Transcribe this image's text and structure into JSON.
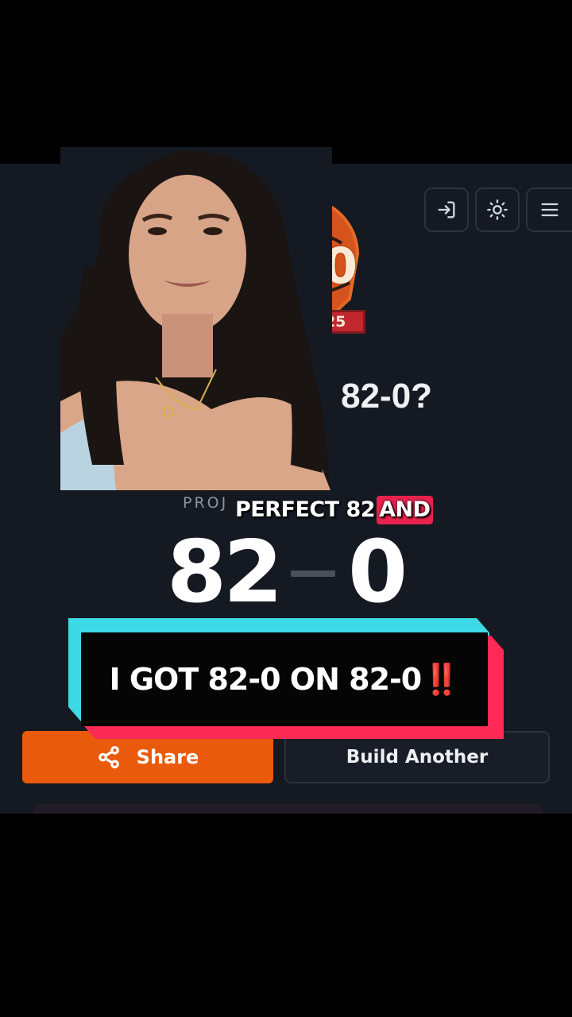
{
  "header": {
    "login_icon": "login-arrow-icon",
    "theme_icon": "sun-icon",
    "menu_icon": "hamburger-menu-icon"
  },
  "logo": {
    "text": "2-0",
    "banner": "T. 2025"
  },
  "hero": {
    "question": "o 82-0?"
  },
  "record": {
    "label": "PROJ",
    "wins": "82",
    "losses": "0"
  },
  "actions": {
    "share_label": "Share",
    "share_icon": "share-icon",
    "build_label": "Build Another"
  },
  "captions": {
    "subtitle_text": "PERFECT 82",
    "subtitle_highlight": "AND",
    "main_text": "I GOT 82-0 ON 82-0",
    "main_emoji": "‼️"
  },
  "colors": {
    "background": "#151922",
    "share_button": "#ea5a0c",
    "caption_cyan": "#3dd9e6",
    "caption_pink": "#fd2a55",
    "logo_red": "#c1272d"
  }
}
